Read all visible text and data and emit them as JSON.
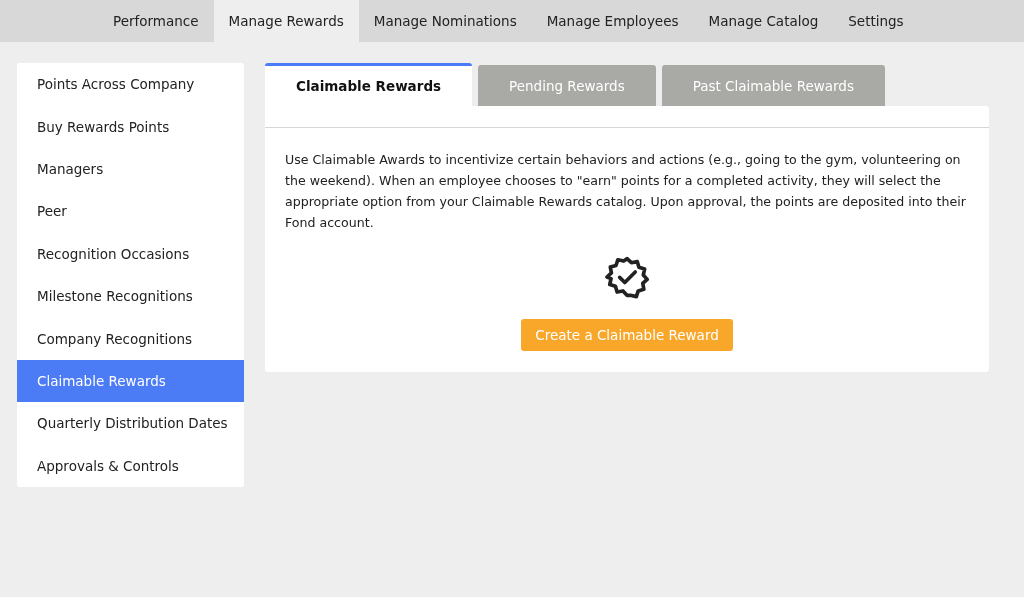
{
  "top_nav": [
    {
      "label": "Performance",
      "selected": false
    },
    {
      "label": "Manage Rewards",
      "selected": true
    },
    {
      "label": "Manage Nominations",
      "selected": false
    },
    {
      "label": "Manage Employees",
      "selected": false
    },
    {
      "label": "Manage Catalog",
      "selected": false
    },
    {
      "label": "Settings",
      "selected": false
    }
  ],
  "sidebar": {
    "items": [
      {
        "label": "Points Across Company",
        "selected": false
      },
      {
        "label": "Buy Rewards Points",
        "selected": false
      },
      {
        "label": "Managers",
        "selected": false
      },
      {
        "label": "Peer",
        "selected": false
      },
      {
        "label": "Recognition Occasions",
        "selected": false
      },
      {
        "label": "Milestone Recognitions",
        "selected": false
      },
      {
        "label": "Company Recognitions",
        "selected": false
      },
      {
        "label": "Claimable Rewards",
        "selected": true
      },
      {
        "label": "Quarterly Distribution Dates",
        "selected": false
      },
      {
        "label": "Approvals & Controls",
        "selected": false
      }
    ]
  },
  "tabs": [
    {
      "label": "Claimable Rewards",
      "selected": true
    },
    {
      "label": "Pending Rewards",
      "selected": false
    },
    {
      "label": "Past Claimable Rewards",
      "selected": false
    }
  ],
  "content": {
    "description": "Use Claimable Awards to incentivize certain behaviors and actions (e.g., going to the gym, volunteering on the weekend). When an employee chooses to \"earn\" points for a completed activity, they will select the appropriate option from your Claimable Rewards catalog. Upon approval, the points are deposited into their Fond account.",
    "button": "Create a Claimable Reward"
  }
}
